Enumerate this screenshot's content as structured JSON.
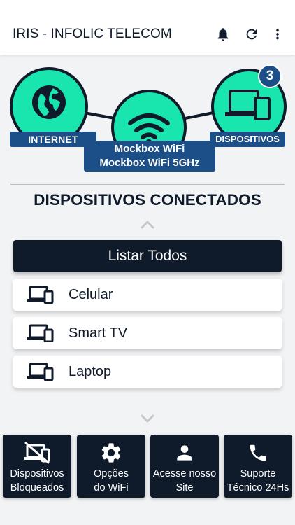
{
  "appbar": {
    "title": "IRIS - INFOLIC TELECOM",
    "icons": [
      "bell-icon",
      "refresh-icon",
      "more-vert-icon"
    ]
  },
  "network": {
    "internet_label": "INTERNET",
    "wifi_names": [
      "Mockbox WiFi",
      "Mockbox WiFi 5GHz"
    ],
    "devices_label": "DISPOSITIVOS",
    "devices_count": "3",
    "icons": [
      "globe-icon",
      "wifi-icon",
      "devices-icon"
    ],
    "colors": {
      "node_fill": "#19e6ae",
      "node_border": "#0f1a2a",
      "label_bg": "#1c4f87"
    }
  },
  "section": {
    "title": "DISPOSITIVOS CONECTADOS"
  },
  "list_all_label": "Listar Todos",
  "devices": [
    {
      "name": "Celular",
      "icon": "devices-icon"
    },
    {
      "name": "Smart TV",
      "icon": "devices-icon"
    },
    {
      "name": "Laptop",
      "icon": "devices-icon"
    }
  ],
  "bottom_actions": [
    {
      "label": "Dispositivos\nBloqueados",
      "icon": "devices-blocked-icon"
    },
    {
      "label": "Opções\ndo WiFi",
      "icon": "gear-icon"
    },
    {
      "label": "Acesse nosso\nSite",
      "icon": "person-icon"
    },
    {
      "label": "Suporte\nTécnico 24Hs",
      "icon": "phone-icon"
    }
  ],
  "colors": {
    "dark": "#0f1a2a",
    "accent": "#19e6ae",
    "blue": "#1c4f87",
    "background": "#f2f3f5"
  }
}
